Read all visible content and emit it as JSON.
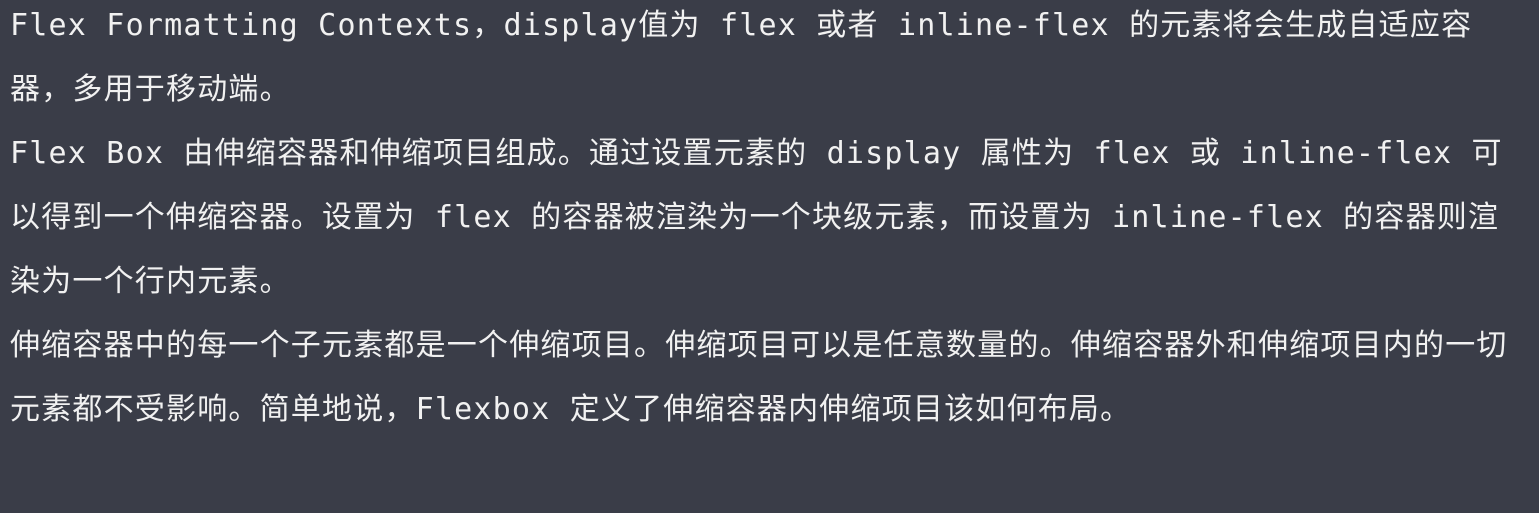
{
  "paragraphs": [
    "Flex Formatting Contexts，display值为 flex 或者 inline-flex 的元素将会生成自适应容器，多用于移动端。",
    "Flex Box 由伸缩容器和伸缩项目组成。通过设置元素的 display 属性为 flex 或 inline-flex 可以得到一个伸缩容器。设置为 flex 的容器被渲染为一个块级元素，而设置为 inline-flex 的容器则渲染为一个行内元素。",
    "伸缩容器中的每一个子元素都是一个伸缩项目。伸缩项目可以是任意数量的。伸缩容器外和伸缩项目内的一切元素都不受影响。简单地说，Flexbox 定义了伸缩容器内伸缩项目该如何布局。"
  ]
}
